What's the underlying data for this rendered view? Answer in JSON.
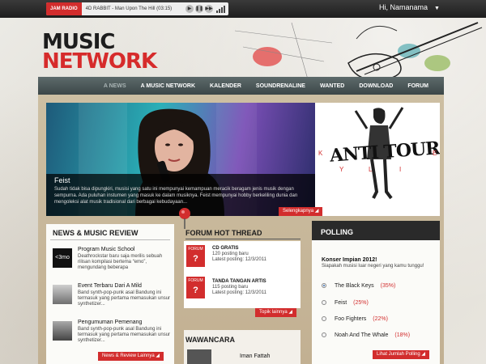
{
  "player": {
    "radio_label": "JAM RADIO",
    "now_playing": "4D RABBIT - Man Upon The Hill (03:15)",
    "controls": [
      "play-icon",
      "pause-icon",
      "next-icon"
    ]
  },
  "user": {
    "greeting": "Hi, Namanama",
    "caret": "▼"
  },
  "logo": {
    "line1": "MUSIC",
    "line2": "NETWORK"
  },
  "nav": {
    "items": [
      "A NEWS",
      "A MUSIC NETWORK",
      "KALENDER",
      "SOUNDRENALINE",
      "WANTED",
      "DOWNLOAD",
      "FORUM"
    ],
    "active": "A NEWS"
  },
  "slider": {
    "title": "Feist",
    "text": "Sudah tidak bisa dipungkiri, musisi yang satu ini mempunyai kemampuan meracik beragam jenis musik dengan sempurna. Ada puluhan instumen yang masuk ke dalam musiknya. Feist mempunyai hobby berkeliling dunia dan mengoleksi alat musik tradisional dari berbagai kebudayaan...",
    "more": "Selengkapnya",
    "poster_title": "ANTI TOUR",
    "poster_letters": [
      "K",
      "Y",
      "L",
      "I",
      "E"
    ]
  },
  "news": {
    "title": "NEWS & MUSIC REVIEW",
    "items": [
      {
        "thumb": "<3mo",
        "title": "Program Music School",
        "desc": "Deathrockstar baru saja merilis sebuah rilisan kompilasi bertema “emo”, mengundang beberapa"
      },
      {
        "thumb": "",
        "title": "Event Terbaru Dari A Mild",
        "desc": "Band synth-pop-punk asal Bandung ini termasuk yang pertama memasukan unsur synthetizer..."
      },
      {
        "thumb": "",
        "title": "Pengumuman Pemenang",
        "desc": "Band synth-pop-punk asal Bandung ini termasuk yang pertama memasukan unsur synthetizer..."
      }
    ],
    "more": "News & Review Lainnya"
  },
  "forum": {
    "title": "FORUM HOT THREAD",
    "badge": "FORUM",
    "items": [
      {
        "title": "CD GRATIS",
        "count": "120 posting baru",
        "last": "Latest posting: 12/3/2011"
      },
      {
        "title": "TANDA TANGAN ARTIS",
        "count": "115 posting baru",
        "last": "Latest posting: 12/3/2011"
      }
    ],
    "more": "Topik lainnya"
  },
  "interview": {
    "title": "WAWANCARA",
    "name": "Iman Fattah"
  },
  "poll": {
    "title": "POLLING",
    "question_title": "Konser Impian 2012!",
    "question": "Siapakah musisi luar negeri yang kamu tunggu!",
    "options": [
      {
        "label": "The Black Keys",
        "pct": "(35%)",
        "selected": true
      },
      {
        "label": "Feist",
        "pct": "(25%)",
        "selected": false
      },
      {
        "label": "Foo Fighters",
        "pct": "(22%)",
        "selected": false
      },
      {
        "label": "Noah And The Whale",
        "pct": "(18%)",
        "selected": false
      }
    ],
    "more": "Lihat Jumlah Polling"
  },
  "colors": {
    "accent": "#d22d2d",
    "nav": "#4b5758",
    "dark": "#1d1d1d"
  }
}
